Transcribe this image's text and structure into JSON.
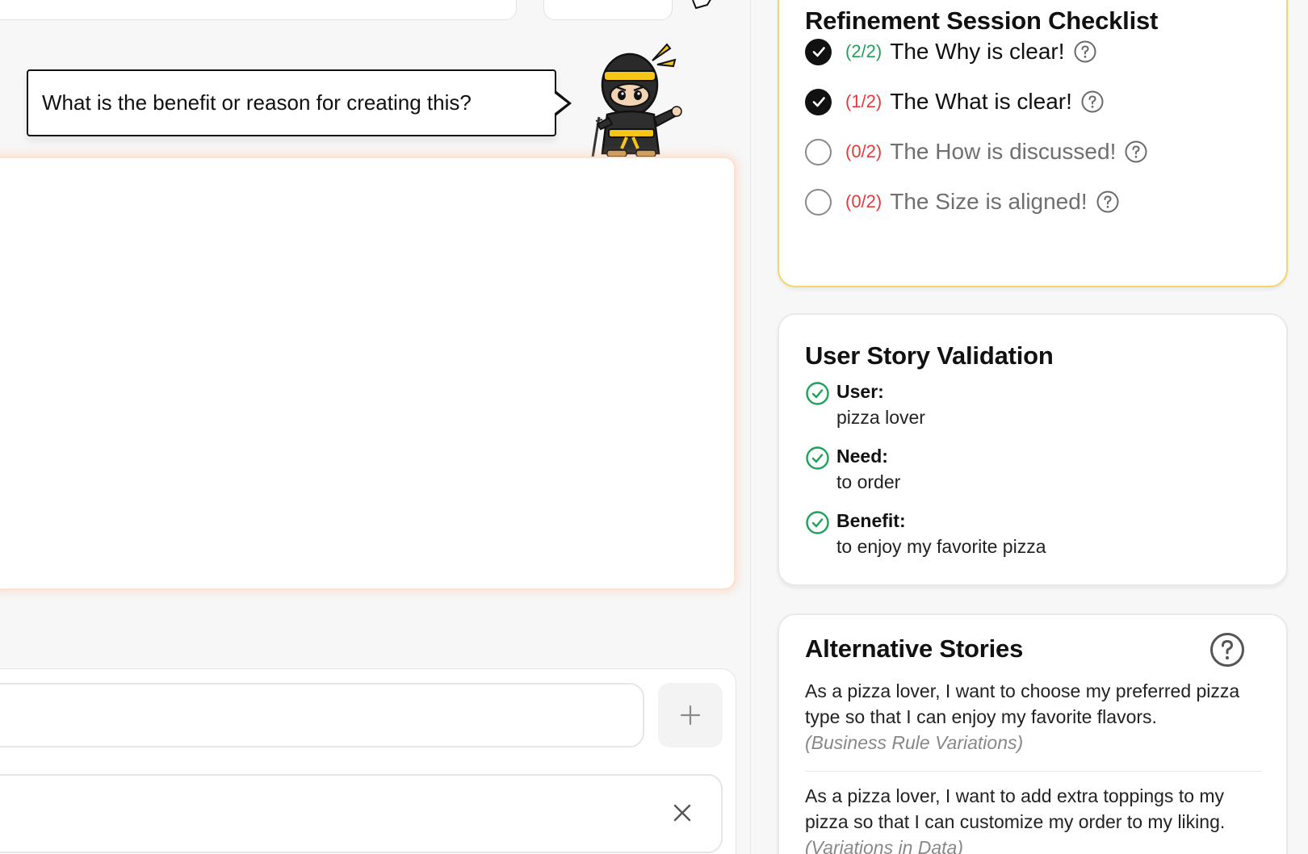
{
  "speech_bubble": {
    "question": "What is the benefit or reason for creating this?"
  },
  "mascot": {
    "icon": "ninja-mascot-icon"
  },
  "composer": {
    "input_value": "",
    "add_icon": "plus-icon",
    "close_icon": "close-icon"
  },
  "checklist": {
    "title": "Refinement Session Checklist",
    "items": [
      {
        "score": "(2/2)",
        "label": "The Why is clear!",
        "done": true,
        "score_color": "green"
      },
      {
        "score": "(1/2)",
        "label": "The What is clear!",
        "done": true,
        "score_color": "red"
      },
      {
        "score": "(0/2)",
        "label": "The How is discussed!",
        "done": false,
        "score_color": "red"
      },
      {
        "score": "(0/2)",
        "label": "The Size is aligned!",
        "done": false,
        "score_color": "red"
      }
    ],
    "help_icon": "question-circle-icon"
  },
  "validation": {
    "title": "User Story Validation",
    "items": [
      {
        "label": "User:",
        "value": "pizza lover"
      },
      {
        "label": "Need:",
        "value": "to order"
      },
      {
        "label": "Benefit:",
        "value": "to enjoy my favorite pizza"
      }
    ],
    "status_icon": "check-circle-icon"
  },
  "alternatives": {
    "title": "Alternative Stories",
    "stories": [
      {
        "text": "As a pizza lover, I want to choose my preferred pizza type so that I can enjoy my favorite flavors.",
        "tag": "(Business Rule Variations)"
      },
      {
        "text": "As a pizza lover, I want to add extra toppings to my pizza so that I can customize my order to my liking.",
        "tag": "(Variations in Data)"
      }
    ]
  },
  "colors": {
    "checklist_border": "#f5d66b",
    "editor_glow": "#fde2cf",
    "score_green": "#22a05a",
    "score_red": "#e23b3b",
    "valid_green": "#22a05a"
  }
}
